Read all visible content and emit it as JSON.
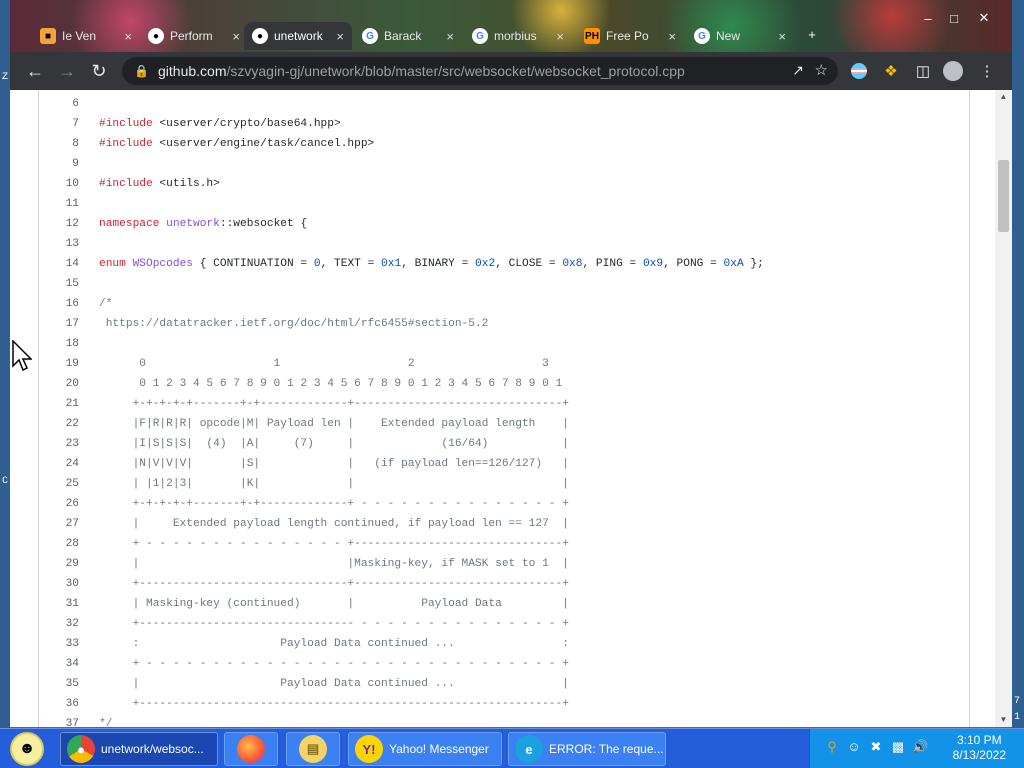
{
  "browser": {
    "tabs": [
      {
        "label": "Ie Ven",
        "icon": "site-icon",
        "color": "#f2a33a"
      },
      {
        "label": "Perform",
        "icon": "github-icon",
        "color": "#ffffff"
      },
      {
        "label": "unetwork",
        "icon": "github-icon",
        "color": "#ffffff",
        "active": true
      },
      {
        "label": "Barack",
        "icon": "google-icon",
        "color": "#4285f4"
      },
      {
        "label": "morbius",
        "icon": "google-icon",
        "color": "#4285f4"
      },
      {
        "label": "Free Po",
        "icon": "ph-icon",
        "badge": "PH",
        "color": "#ff9000"
      },
      {
        "label": "New",
        "icon": "google-icon",
        "color": "#4285f4"
      }
    ],
    "new_tab_label": "+",
    "url_host": "github.com",
    "url_path": "/szvyagin-gj/unetwork/blob/master/src/websocket/websocket_protocol.cpp"
  },
  "code": {
    "lines": [
      {
        "n": "6",
        "html": ""
      },
      {
        "n": "7",
        "html": "<span class=\"kw\">#include</span> &lt;userver/crypto/base64.hpp&gt;"
      },
      {
        "n": "8",
        "html": "<span class=\"kw\">#include</span> &lt;userver/engine/task/cancel.hpp&gt;"
      },
      {
        "n": "9",
        "html": ""
      },
      {
        "n": "10",
        "html": "<span class=\"kw\">#include</span> &lt;utils.h&gt;"
      },
      {
        "n": "11",
        "html": ""
      },
      {
        "n": "12",
        "html": "<span class=\"kw\">namespace</span> <span class=\"ty\">unetwork</span>::websocket {"
      },
      {
        "n": "13",
        "html": ""
      },
      {
        "n": "14",
        "html": "<span class=\"kw\">enum</span> <span class=\"ty\">WSOpcodes</span> { CONTINUATION = <span class=\"num\">0</span>, TEXT = <span class=\"num\">0x1</span>, BINARY = <span class=\"num\">0x2</span>, CLOSE = <span class=\"num\">0x8</span>, PING = <span class=\"num\">0x9</span>, PONG = <span class=\"num\">0xA</span> };"
      },
      {
        "n": "15",
        "html": ""
      },
      {
        "n": "16",
        "html": "<span class=\"cm\">/*</span>"
      },
      {
        "n": "17",
        "html": "<span class=\"cm\"> https://datatracker.ietf.org/doc/html/rfc6455#section-5.2</span>"
      },
      {
        "n": "18",
        "html": ""
      },
      {
        "n": "19",
        "html": "<span class=\"cm\">      0                   1                   2                   3</span>"
      },
      {
        "n": "20",
        "html": "<span class=\"cm\">      0 1 2 3 4 5 6 7 8 9 0 1 2 3 4 5 6 7 8 9 0 1 2 3 4 5 6 7 8 9 0 1</span>"
      },
      {
        "n": "21",
        "html": "<span class=\"cm\">     +-+-+-+-+-------+-+-------------+-------------------------------+</span>"
      },
      {
        "n": "22",
        "html": "<span class=\"cm\">     |F|R|R|R| opcode|M| Payload len |    Extended payload length    |</span>"
      },
      {
        "n": "23",
        "html": "<span class=\"cm\">     |I|S|S|S|  (4)  |A|     (7)     |             (16/64)           |</span>"
      },
      {
        "n": "24",
        "html": "<span class=\"cm\">     |N|V|V|V|       |S|             |   (if payload len==126/127)   |</span>"
      },
      {
        "n": "25",
        "html": "<span class=\"cm\">     | |1|2|3|       |K|             |                               |</span>"
      },
      {
        "n": "26",
        "html": "<span class=\"cm\">     +-+-+-+-+-------+-+-------------+ - - - - - - - - - - - - - - - +</span>"
      },
      {
        "n": "27",
        "html": "<span class=\"cm\">     |     Extended payload length continued, if payload len == 127  |</span>"
      },
      {
        "n": "28",
        "html": "<span class=\"cm\">     + - - - - - - - - - - - - - - - +-------------------------------+</span>"
      },
      {
        "n": "29",
        "html": "<span class=\"cm\">     |                               |Masking-key, if MASK set to 1  |</span>"
      },
      {
        "n": "30",
        "html": "<span class=\"cm\">     +-------------------------------+-------------------------------+</span>"
      },
      {
        "n": "31",
        "html": "<span class=\"cm\">     | Masking-key (continued)       |          Payload Data         |</span>"
      },
      {
        "n": "32",
        "html": "<span class=\"cm\">     +-------------------------------- - - - - - - - - - - - - - - - +</span>"
      },
      {
        "n": "33",
        "html": "<span class=\"cm\">     :                     Payload Data continued ...                :</span>"
      },
      {
        "n": "34",
        "html": "<span class=\"cm\">     + - - - - - - - - - - - - - - - - - - - - - - - - - - - - - - - +</span>"
      },
      {
        "n": "35",
        "html": "<span class=\"cm\">     |                     Payload Data continued ...                |</span>"
      },
      {
        "n": "36",
        "html": "<span class=\"cm\">     +---------------------------------------------------------------+</span>"
      },
      {
        "n": "37",
        "html": "<span class=\"cm\">*/</span>"
      }
    ]
  },
  "taskbar": {
    "items": [
      {
        "label": "unetwork/websoc...",
        "icon": "chrome-icon",
        "active": true
      },
      {
        "label": "",
        "icon": "firefox-icon"
      },
      {
        "label": "",
        "icon": "folder-icon"
      },
      {
        "label": "Yahoo! Messenger",
        "icon": "yahoo-messenger-icon"
      },
      {
        "label": "ERROR: The reque...",
        "icon": "internet-explorer-icon"
      }
    ],
    "clock_time": "3:10 PM",
    "clock_date": "8/13/2022"
  },
  "desktop": {
    "edge_right_top": "7",
    "edge_right_bottom": "1",
    "edge_left_a": "Z",
    "edge_left_b": "C"
  },
  "colors": {
    "keyword": "#cf222e",
    "type": "#8250df",
    "number": "#0550ae",
    "comment": "#6e7781",
    "taskbar": "#245edb"
  }
}
